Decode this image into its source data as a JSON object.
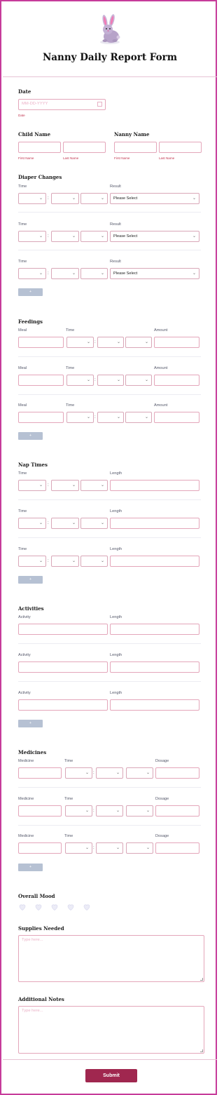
{
  "form": {
    "title": "Nanny Daily Report Form",
    "submit_label": "Submit",
    "add_label": "+"
  },
  "date": {
    "section_label": "Date",
    "placeholder": "MM-DD-YYYY",
    "sublabel": "Date"
  },
  "child_name": {
    "section_label": "Child Name",
    "first_label": "First Name",
    "last_label": "Last Name"
  },
  "nanny_name": {
    "section_label": "Nanny Name",
    "first_label": "First Name",
    "last_label": "Last Name"
  },
  "diaper_changes": {
    "section_label": "Diaper Changes",
    "time_label": "Time",
    "result_label": "Result",
    "result_value": "Please Select",
    "colon": ":"
  },
  "feedings": {
    "section_label": "Feedings",
    "meal_label": "Meal",
    "time_label": "Time",
    "amount_label": "Amount",
    "colon": ":"
  },
  "nap_times": {
    "section_label": "Nap Times",
    "time_label": "Time",
    "length_label": "Length",
    "colon": ":"
  },
  "activities": {
    "section_label": "Activities",
    "activity_label": "Activity",
    "length_label": "Length"
  },
  "medicines": {
    "section_label": "Medicines",
    "medicine_label": "Medicine",
    "time_label": "Time",
    "dosage_label": "Dosage",
    "colon": ":"
  },
  "overall_mood": {
    "section_label": "Overall Mood",
    "rating_count": 5,
    "rating_value": 0
  },
  "supplies_needed": {
    "section_label": "Supplies Needed",
    "placeholder": "Type here..."
  },
  "additional_notes": {
    "section_label": "Additional Notes",
    "placeholder": "Type here..."
  },
  "colors": {
    "border": "#c63b9a",
    "accent": "#a0274f",
    "input_border": "#e4a6ba",
    "add_button": "#b6c1d3",
    "heart": "#dcdcf0"
  }
}
